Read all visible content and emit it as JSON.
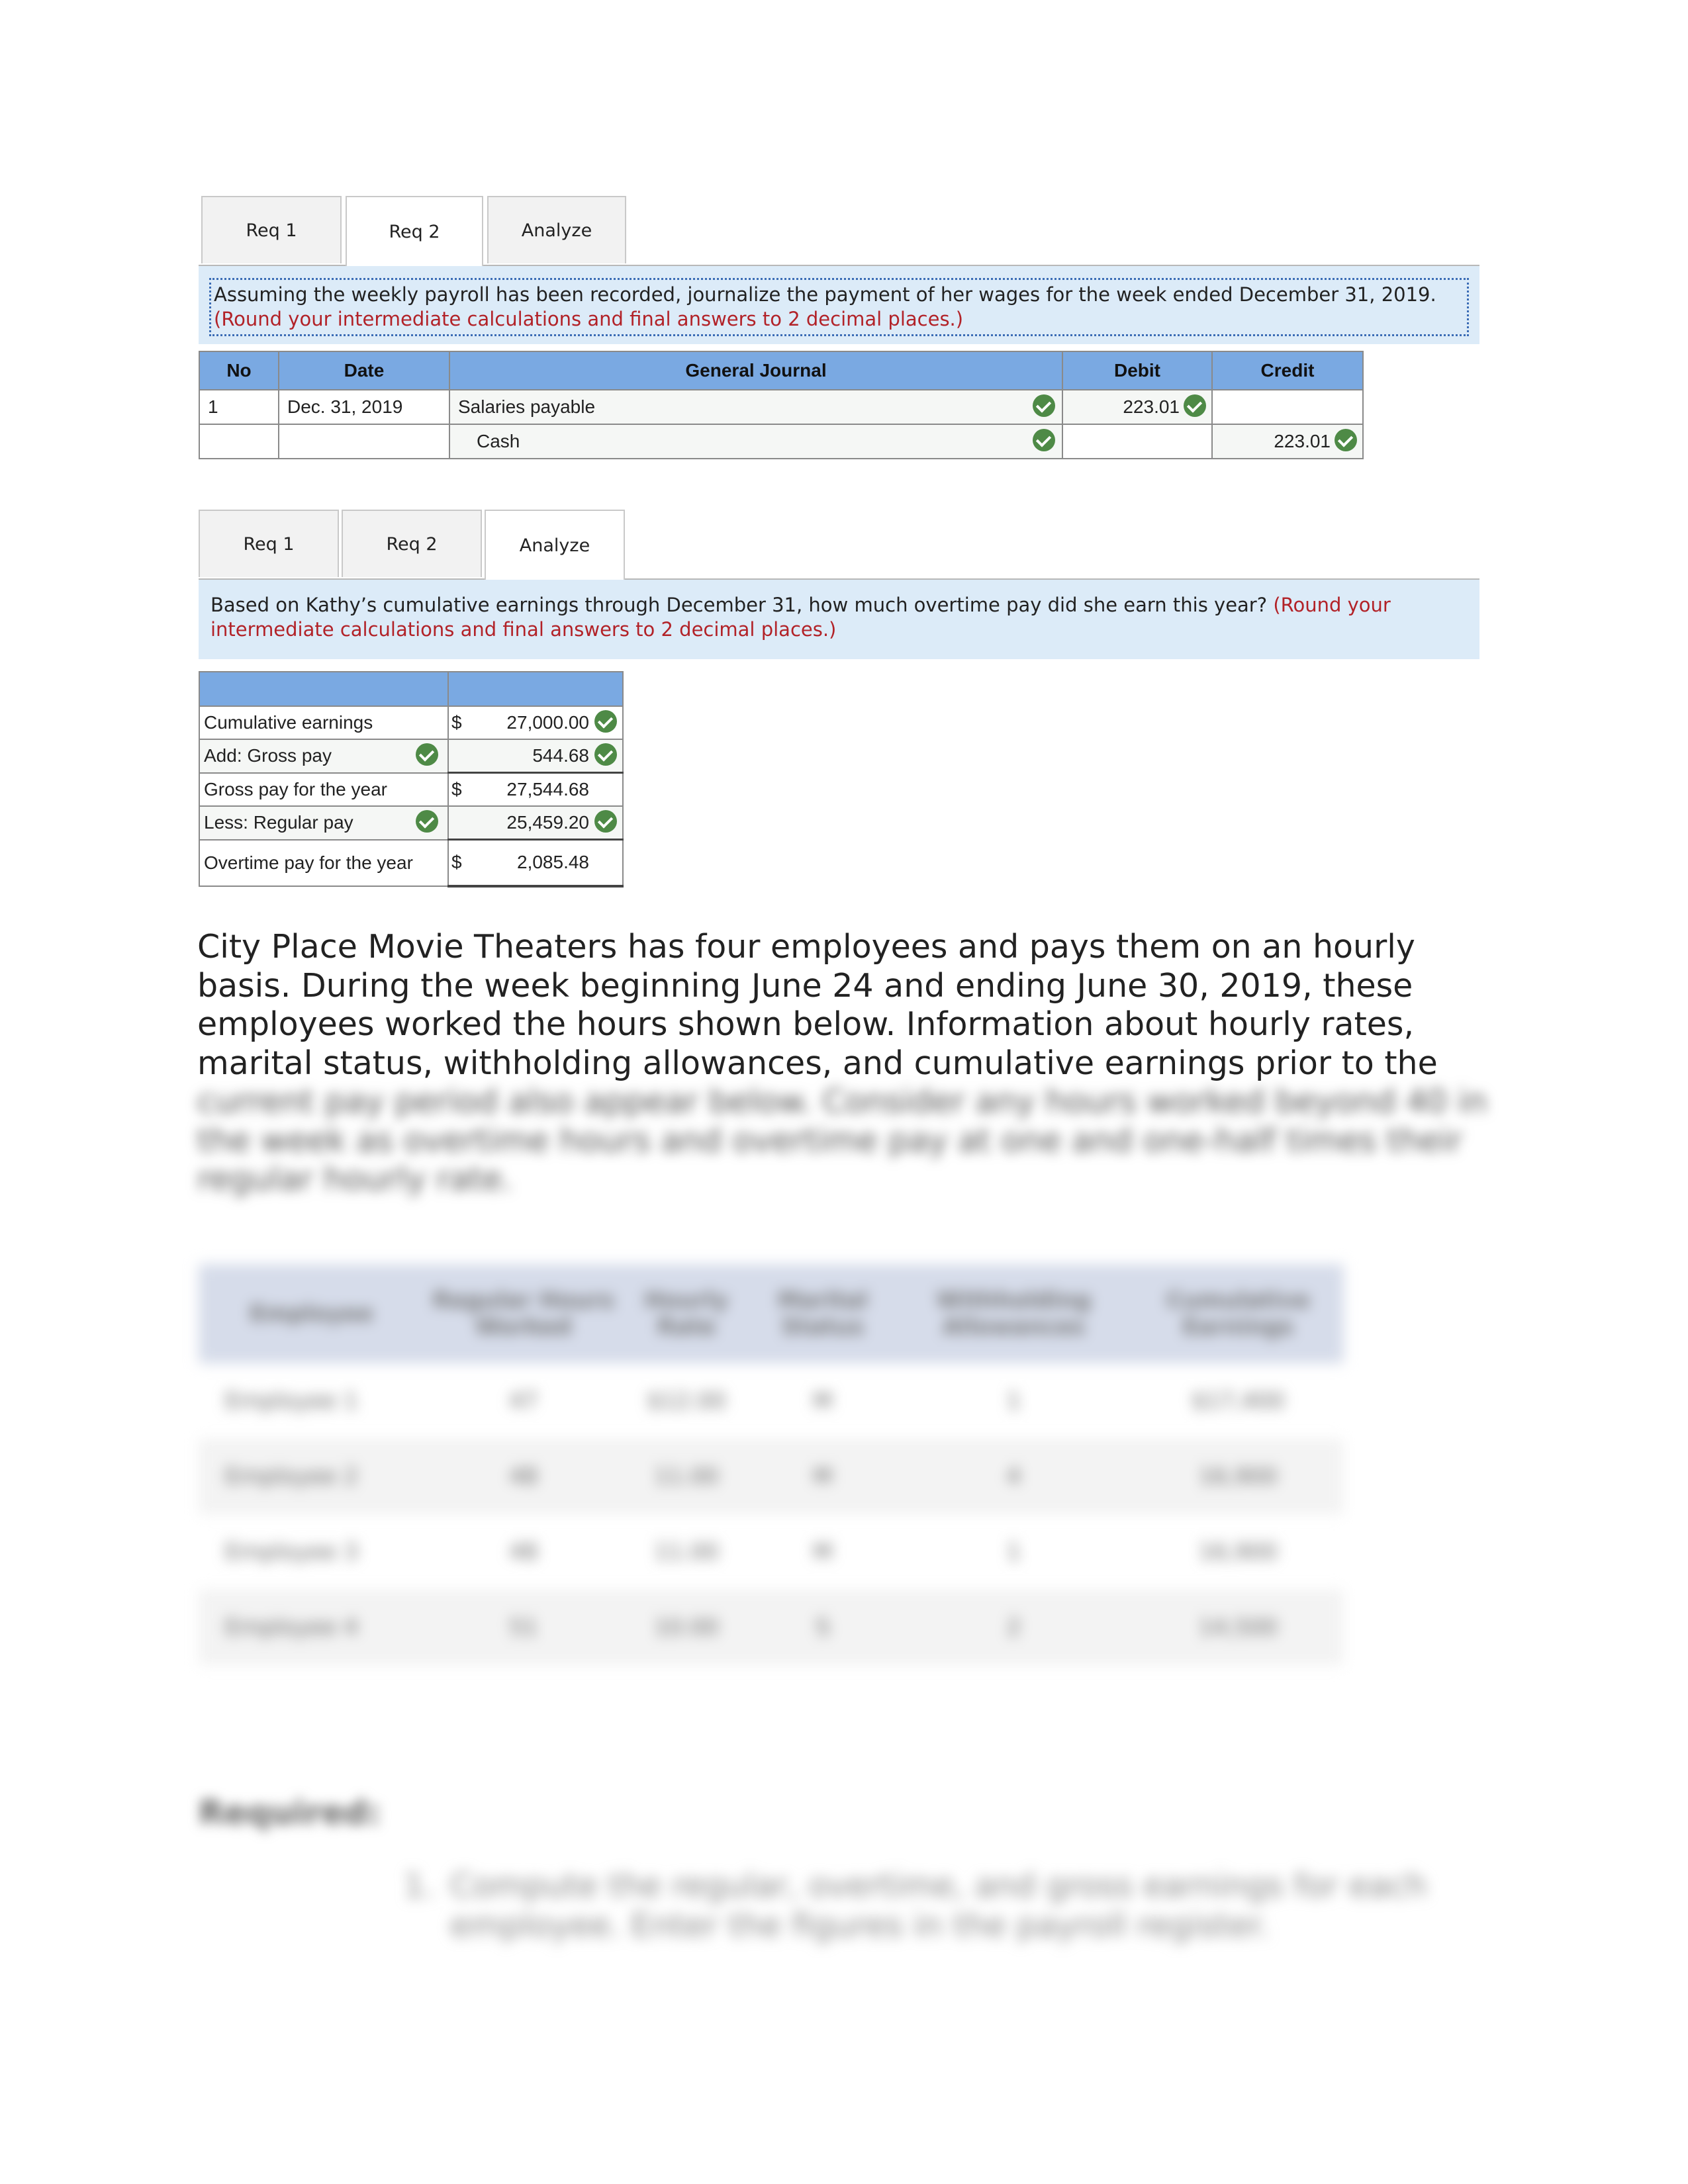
{
  "section1": {
    "tabs": [
      {
        "label": "Req 1",
        "active": false
      },
      {
        "label": "Req 2",
        "active": true
      },
      {
        "label": "Analyze",
        "active": false
      }
    ],
    "instruction": "Assuming the weekly payroll has been recorded, journalize the payment of her wages for the week ended December 31, 2019.",
    "instruction_note": "(Round your intermediate calculations and final answers to 2 decimal places.)",
    "journal": {
      "headers": [
        "No",
        "Date",
        "General Journal",
        "Debit",
        "Credit"
      ],
      "rows": [
        {
          "no": "1",
          "date": "Dec. 31, 2019",
          "account": "Salaries payable",
          "debit": "223.01",
          "credit": "",
          "account_correct": true,
          "debit_correct": true
        },
        {
          "no": "",
          "date": "",
          "account": "Cash",
          "debit": "",
          "credit": "223.01",
          "account_correct": true,
          "credit_correct": true
        }
      ]
    }
  },
  "section2": {
    "tabs": [
      {
        "label": "Req 1",
        "active": false
      },
      {
        "label": "Req 2",
        "active": false
      },
      {
        "label": "Analyze",
        "active": true
      }
    ],
    "instruction": "Based on Kathy’s cumulative earnings through December 31, how much overtime pay did she earn this year?",
    "instruction_note": "(Round your intermediate calculations and final answers to 2 decimal places.)",
    "analysis": {
      "rows": [
        {
          "label": "Cumulative earnings",
          "dollar": "$",
          "value": "27,000.00",
          "label_check": false,
          "value_check": true
        },
        {
          "label": "Add: Gross pay",
          "dollar": "",
          "value": "544.68",
          "label_check": true,
          "value_check": true
        },
        {
          "label": "Gross pay for the year",
          "dollar": "$",
          "value": "27,544.68",
          "label_check": false,
          "value_check": false
        },
        {
          "label": "Less: Regular pay",
          "dollar": "",
          "value": "25,459.20",
          "label_check": true,
          "value_check": true
        },
        {
          "label": "Overtime pay for the year",
          "dollar": "$",
          "value": "2,085.48",
          "label_check": false,
          "value_check": false
        }
      ]
    }
  },
  "problem": {
    "text_visible": "City Place Movie Theaters has four employees and pays them on an hourly basis. During the week beginning June 24 and ending June 30, 2019, these employees worked the hours shown below. Information about hourly rates, marital status, withholding allowances, and cumulative earnings prior to the",
    "text_blurred": "current pay period also appear below. Consider any hours worked beyond 40 in the week as overtime hours and overtime pay at one and one-half times their regular hourly rate."
  },
  "employee_table": {
    "headers": [
      "Employee",
      "Regular Hours Worked",
      "Hourly Rate",
      "Marital Status",
      "Withholding Allowances",
      "Cumulative Earnings"
    ],
    "rows": [
      [
        "Employee 1",
        "47",
        "$12.00",
        "M",
        "1",
        "$17,400"
      ],
      [
        "Employee 2",
        "48",
        "11.00",
        "M",
        "4",
        "16,900"
      ],
      [
        "Employee 3",
        "48",
        "11.00",
        "M",
        "1",
        "16,900"
      ],
      [
        "Employee 4",
        "51",
        "10.00",
        "S",
        "2",
        "14,500"
      ]
    ]
  },
  "required": {
    "heading": "Required:",
    "item_number": "1.",
    "item_text": "Compute the regular, overtime, and gross earnings for each employee. Enter the figures in the payroll register."
  }
}
